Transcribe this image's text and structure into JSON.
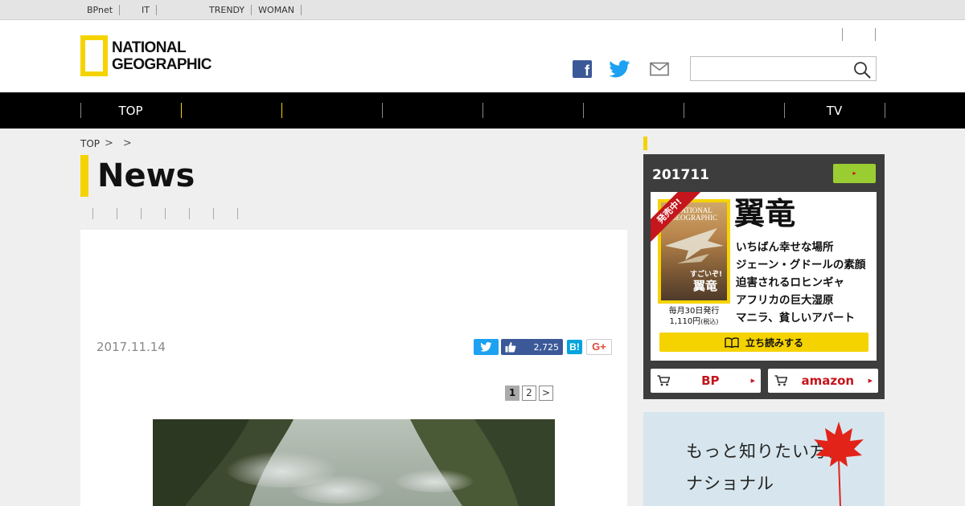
{
  "topbar": {
    "links": [
      "BPnet",
      "",
      "IT",
      "",
      "",
      "",
      "TRENDY",
      "WOMAN",
      "",
      "",
      ""
    ]
  },
  "header": {
    "logo_line1": "NATIONAL",
    "logo_line2": "GEOGRAPHIC",
    "social_icons": [
      "facebook-icon",
      "twitter-icon",
      "mail-icon"
    ],
    "search_placeholder": "",
    "brand_color": "#f5d300"
  },
  "gnav": {
    "items": [
      "TOP",
      "",
      "",
      "",
      "",
      "",
      "",
      "TV"
    ]
  },
  "breadcrumb": {
    "home": "TOP",
    "sep": ">"
  },
  "page": {
    "title": "News"
  },
  "article": {
    "date": "2017.11.14",
    "like_count": "2,725",
    "hatena_label": "B!",
    "gplus_label": "G+",
    "pages": [
      "1",
      "2",
      ">"
    ]
  },
  "sidebar": {
    "issue": "201711",
    "green_label": "▸",
    "ribbon": "発売中!",
    "cover_ng1": "NATIONAL",
    "cover_ng2": "GEOGRAPHIC",
    "cover_sub": "すごいぞ!",
    "cover_word": "翼竜",
    "feature_title": "翼竜",
    "feature_lines": [
      "いちばん幸せな場所",
      "ジェーン・グドールの素顔",
      "迫害されるロヒンギャ",
      "アフリカの巨大湿原",
      "マニラ、貧しいアパート"
    ],
    "schedule": "毎月30日発行",
    "price": "1,110円",
    "price_tax": "(税込)",
    "read_button": "立ち読みする",
    "buy_bp": "BP",
    "buy_amazon": "amazon",
    "ad_line1": "もっと知りたい方は",
    "ad_line2": "ナショナル"
  }
}
